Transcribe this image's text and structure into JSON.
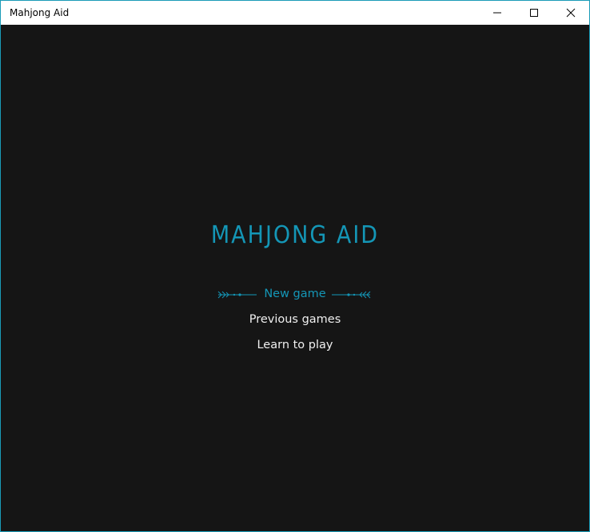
{
  "window": {
    "title": "Mahjong Aid"
  },
  "app": {
    "title": "MAHJONG AID",
    "accent_color": "#1496b6",
    "background_color": "#151515"
  },
  "menu": {
    "items": [
      {
        "label": "New game",
        "selected": true
      },
      {
        "label": "Previous games",
        "selected": false
      },
      {
        "label": "Learn to play",
        "selected": false
      }
    ]
  },
  "icons": {
    "minimize": "minimize-icon",
    "maximize": "maximize-icon",
    "close": "close-icon",
    "selection_ornament": "arrow-ornament-icon"
  }
}
